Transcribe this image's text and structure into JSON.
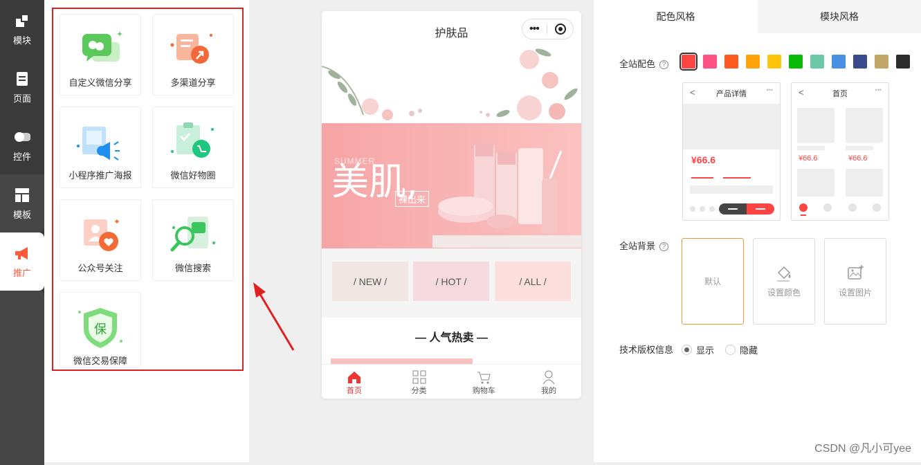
{
  "nav": {
    "items": [
      {
        "label": "模块",
        "icon": "module-icon"
      },
      {
        "label": "页面",
        "icon": "page-icon"
      },
      {
        "label": "控件",
        "icon": "toggle-icon"
      },
      {
        "label": "模板",
        "icon": "template-icon"
      },
      {
        "label": "推广",
        "icon": "megaphone-icon",
        "active": true
      }
    ]
  },
  "panel": {
    "cards": [
      {
        "label": "自定义微信分享",
        "icon": "wechat-share-icon"
      },
      {
        "label": "多渠道分享",
        "icon": "multi-channel-share-icon"
      },
      {
        "label": "小程序推广海报",
        "icon": "poster-icon"
      },
      {
        "label": "微信好物圈",
        "icon": "goods-circle-icon"
      },
      {
        "label": "公众号关注",
        "icon": "follow-icon"
      },
      {
        "label": "微信搜索",
        "icon": "wechat-search-icon"
      },
      {
        "label": "微信交易保障",
        "icon": "trade-guarantee-icon",
        "badge": "保"
      }
    ]
  },
  "preview": {
    "title": "护肤品",
    "banner": {
      "script": "SUMMER",
      "headline": "美肌,",
      "tagline": "裸出来"
    },
    "categories": [
      "/ NEW /",
      "/ HOT /",
      "/ ALL /"
    ],
    "section_title": "— 人气热卖 —",
    "tabs": [
      {
        "label": "首页",
        "icon": "home-icon",
        "active": true
      },
      {
        "label": "分类",
        "icon": "category-icon"
      },
      {
        "label": "购物车",
        "icon": "cart-icon"
      },
      {
        "label": "我的",
        "icon": "user-icon"
      }
    ]
  },
  "settings": {
    "tabs": [
      "配色风格",
      "模块风格"
    ],
    "color_label": "全站配色",
    "colors": [
      "#ff4444",
      "#ff5383",
      "#ff5a1f",
      "#ffa30c",
      "#ffc40b",
      "#09bb07",
      "#6cc9a8",
      "#4a90e2",
      "#3a4a8c",
      "#c3a769",
      "#2b2b2b"
    ],
    "selected_color": "#ff4444",
    "mini_product": {
      "title": "产品详情",
      "price": "¥66.6"
    },
    "mini_home": {
      "title": "首页",
      "price1": "¥66.6",
      "price2": "¥66.6"
    },
    "bg_label": "全站背景",
    "bg_options": [
      {
        "label": "默认",
        "selected": true
      },
      {
        "label": "设置颜色",
        "icon": "paint-bucket-icon"
      },
      {
        "label": "设置图片",
        "icon": "add-image-icon"
      }
    ],
    "copyright_label": "技术版权信息",
    "copyright_options": [
      "显示",
      "隐藏"
    ]
  },
  "watermark": "CSDN @凡小可yee"
}
